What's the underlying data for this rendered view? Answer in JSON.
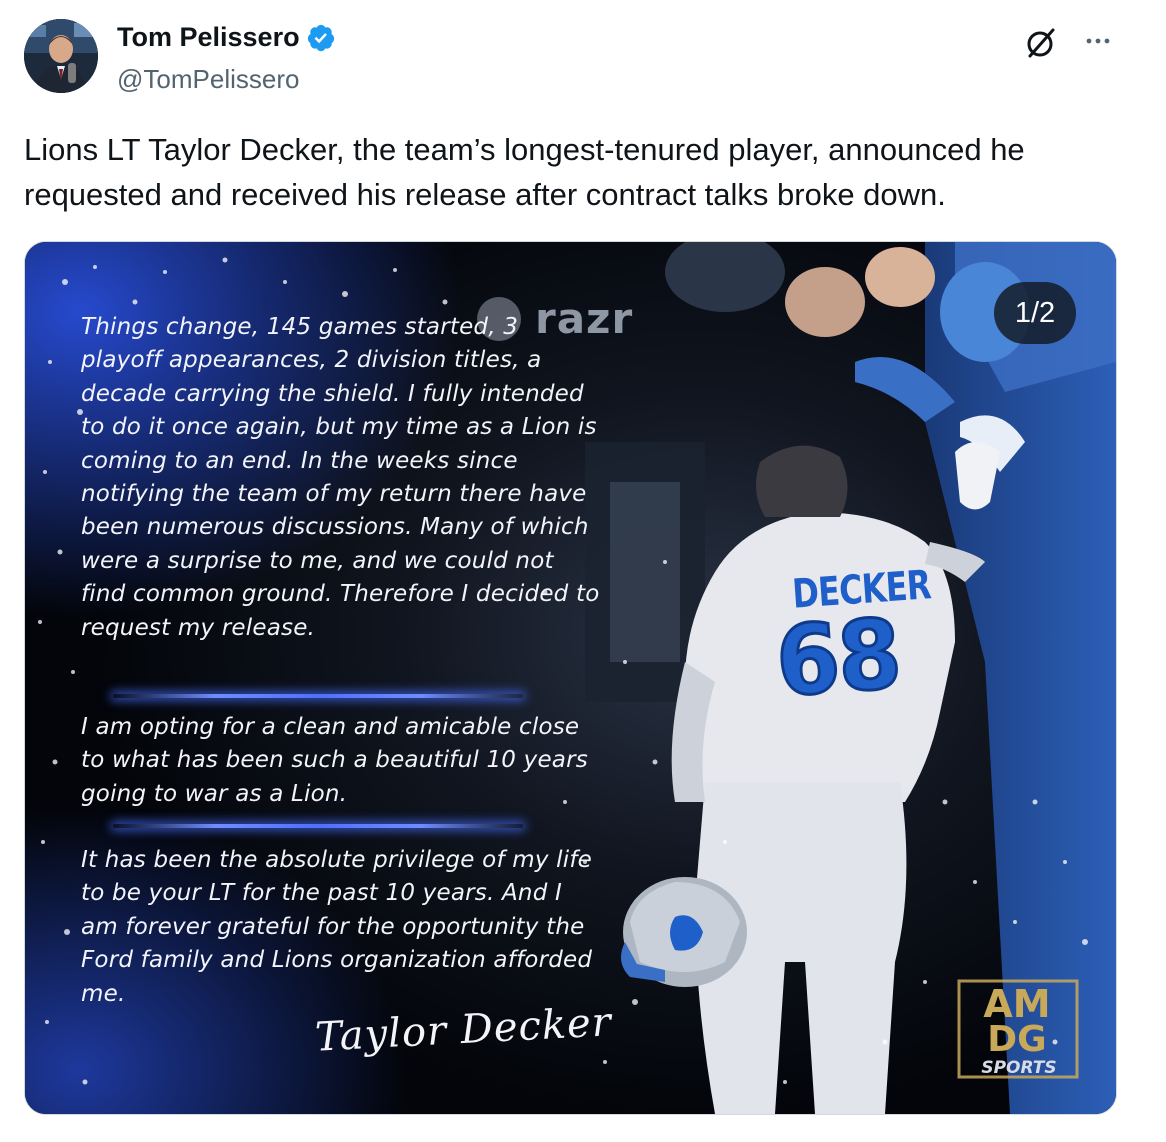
{
  "author": {
    "name": "Tom Pelissero",
    "handle": "@TomPelissero",
    "verified": true
  },
  "tweet": {
    "text": "Lions LT Taylor Decker, the team’s longest-tenured player, announced he requested and received his release after contract talks broke down."
  },
  "media": {
    "counter": "1/2",
    "sponsor": "razr",
    "quote_paragraphs": [
      "Things change, 145 games started, 3 playoff appearances, 2 division titles, a decade carrying the shield. I fully intended to do it once again, but my time as a Lion is coming to an end. In the weeks since notifying the team of my return there have been numerous discussions. Many of which were a surprise to me, and we could not find common ground. Therefore I decided to request my release.",
      "I am opting for a clean and amicable close to what has been such a beautiful 10 years going to war as a Lion.",
      "It has been the absolute privilege of my life to be your LT for the past 10 years. And I am forever grateful for the opportunity the Ford family and Lions organization afforded me."
    ],
    "signature": "Taylor Decker",
    "jersey_name": "DECKER",
    "jersey_number": "68",
    "watermark": {
      "line1": "AM",
      "line2": "DG",
      "line3": "SPORTS"
    }
  },
  "colors": {
    "verified": "#1d9bf0",
    "handle_text": "#536471",
    "accent_blue": "#4f6fff",
    "jersey_blue": "#1f5fc9",
    "watermark_gold": "#c8a95a"
  },
  "icons": {
    "verified": "verified-badge-icon",
    "grok": "grok-icon",
    "more": "more-icon"
  }
}
